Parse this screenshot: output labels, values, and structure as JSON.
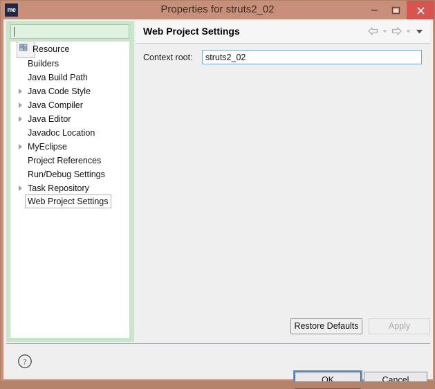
{
  "window": {
    "title": "Properties for struts2_02",
    "app_icon_label": "me",
    "controls": {
      "minimize": "minimize-icon",
      "maximize": "maximize-icon",
      "close": "close-icon"
    },
    "colors": {
      "titlebar": "#c8907b",
      "close_button": "#d9534f",
      "sidebar": "#c8e6c9",
      "dialog": "#efefef",
      "focus_ring": "#5a93d6",
      "input_border": "#7aa7c7"
    }
  },
  "sidebar": {
    "filter": {
      "value": "",
      "placeholder": ""
    },
    "items": [
      {
        "label": "Resource",
        "expandable": false,
        "selected": false,
        "has_icon": true
      },
      {
        "label": "Builders",
        "expandable": false,
        "selected": false,
        "has_icon": false
      },
      {
        "label": "Java Build Path",
        "expandable": false,
        "selected": false,
        "has_icon": false
      },
      {
        "label": "Java Code Style",
        "expandable": true,
        "selected": false,
        "has_icon": false
      },
      {
        "label": "Java Compiler",
        "expandable": true,
        "selected": false,
        "has_icon": false
      },
      {
        "label": "Java Editor",
        "expandable": true,
        "selected": false,
        "has_icon": false
      },
      {
        "label": "Javadoc Location",
        "expandable": false,
        "selected": false,
        "has_icon": false
      },
      {
        "label": "MyEclipse",
        "expandable": true,
        "selected": false,
        "has_icon": false
      },
      {
        "label": "Project References",
        "expandable": false,
        "selected": false,
        "has_icon": false
      },
      {
        "label": "Run/Debug Settings",
        "expandable": false,
        "selected": false,
        "has_icon": false
      },
      {
        "label": "Task Repository",
        "expandable": true,
        "selected": false,
        "has_icon": false
      },
      {
        "label": "Web Project Settings",
        "expandable": false,
        "selected": true,
        "has_icon": false
      }
    ]
  },
  "page": {
    "title": "Web Project Settings",
    "nav": {
      "back": "back-arrow-icon",
      "back_menu": "chevron-down-icon",
      "forward": "forward-arrow-icon",
      "forward_menu": "chevron-down-icon",
      "view_menu": "chevron-down-icon"
    },
    "fields": {
      "context_root_label": "Context root:",
      "context_root_value": "struts2_02",
      "context_root_placeholder": ""
    },
    "restore_defaults_label": "Restore Defaults",
    "apply_label": "Apply",
    "apply_enabled": false
  },
  "footer": {
    "help_icon": "help-icon",
    "ok_label": "OK",
    "cancel_label": "Cancel"
  },
  "backdrop": {
    "strip_text": ""
  }
}
